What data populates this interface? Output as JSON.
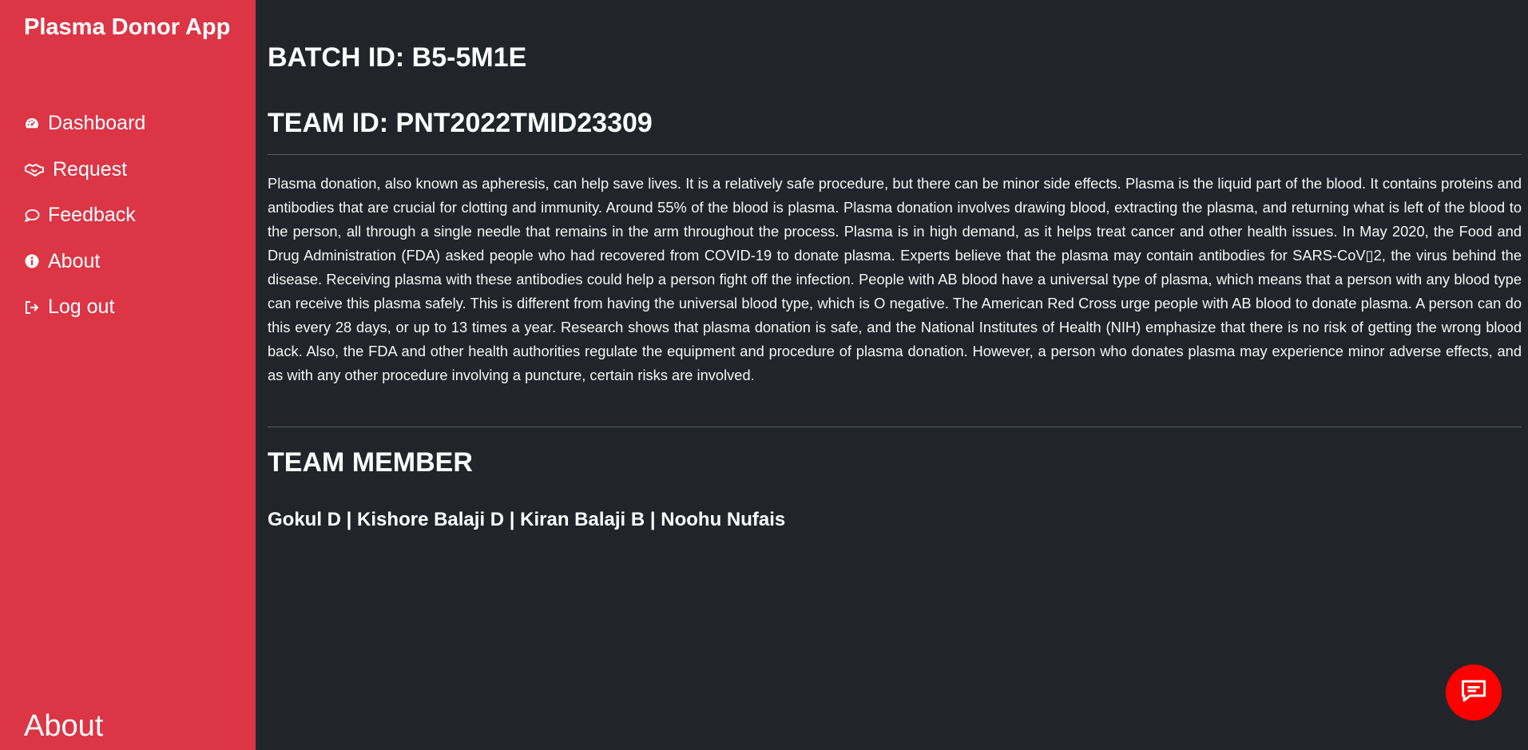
{
  "sidebar": {
    "brand": "Plasma Donor App",
    "items": [
      {
        "label": "Dashboard",
        "icon": "dashboard-icon"
      },
      {
        "label": "Request",
        "icon": "handshake-icon"
      },
      {
        "label": "Feedback",
        "icon": "comment-icon"
      },
      {
        "label": "About",
        "icon": "info-icon"
      },
      {
        "label": "Log out",
        "icon": "sign-out-icon"
      }
    ],
    "footer": "About",
    "color": "#dc3545"
  },
  "main": {
    "batch_id": "BATCH ID: B5-5M1E",
    "team_id": "TEAM ID: PNT2022TMID23309",
    "description": "Plasma donation, also known as apheresis, can help save lives. It is a relatively safe procedure, but there can be minor side effects. Plasma is the liquid part of the blood. It contains proteins and antibodies that are crucial for clotting and immunity. Around 55% of the blood is plasma. Plasma donation involves drawing blood, extracting the plasma, and returning what is left of the blood to the person, all through a single needle that remains in the arm throughout the process. Plasma is in high demand, as it helps treat cancer and other health issues. In May 2020, the Food and Drug Administration (FDA) asked people who had recovered from COVID-19 to donate plasma. Experts believe that the plasma may contain antibodies for SARS-CoV▯2, the virus behind the disease. Receiving plasma with these antibodies could help a person fight off the infection. People with AB blood have a universal type of plasma, which means that a person with any blood type can receive this plasma safely. This is different from having the universal blood type, which is O negative. The American Red Cross urge people with AB blood to donate plasma. A person can do this every 28 days, or up to 13 times a year. Research shows that plasma donation is safe, and the National Institutes of Health (NIH) emphasize that there is no risk of getting the wrong blood back. Also, the FDA and other health authorities regulate the equipment and procedure of plasma donation. However, a person who donates plasma may experience minor adverse effects, and as with any other procedure involving a puncture, certain risks are involved.",
    "team_heading": "TEAM MEMBER",
    "members": "Gokul D | Kishore Balaji D | Kiran Balaji B | Noohu Nufais",
    "background": "#212529"
  },
  "chat_button": {
    "icon": "chat-icon",
    "color": "#ff0000"
  }
}
